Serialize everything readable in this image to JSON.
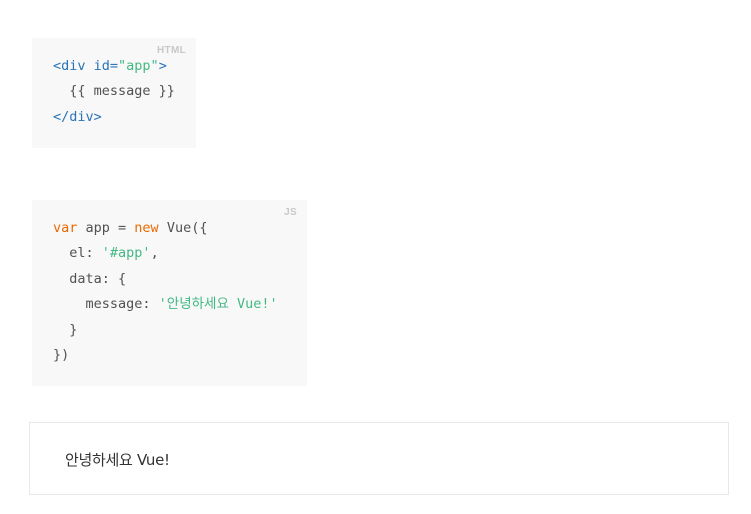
{
  "html_example": {
    "lang_label": "HTML",
    "line1": {
      "open_tag": "<div",
      "space": " ",
      "attr_name": "id=",
      "attr_value": "\"app\"",
      "close": ">"
    },
    "line2": {
      "indent": "  ",
      "text": "{{ message }}"
    },
    "line3": {
      "closing_tag": "</div>"
    }
  },
  "js_example": {
    "lang_label": "JS",
    "line1": {
      "kw_var": "var",
      "mid": " app = ",
      "kw_new": "new",
      "end": " Vue({"
    },
    "line2": {
      "prefix": "  el: ",
      "value": "'#app'",
      "suffix": ","
    },
    "line3": {
      "text": "  data: {"
    },
    "line4": {
      "prefix": "    message: ",
      "value": "'안녕하세요 Vue!'"
    },
    "line5": {
      "text": "  }"
    },
    "line6": {
      "text": "})"
    }
  },
  "result": {
    "text": "안녕하세요 Vue!"
  },
  "colors": {
    "tag": "#2973b7",
    "string": "#42b983",
    "keyword": "#e96900",
    "code_background": "#f8f8f8"
  }
}
